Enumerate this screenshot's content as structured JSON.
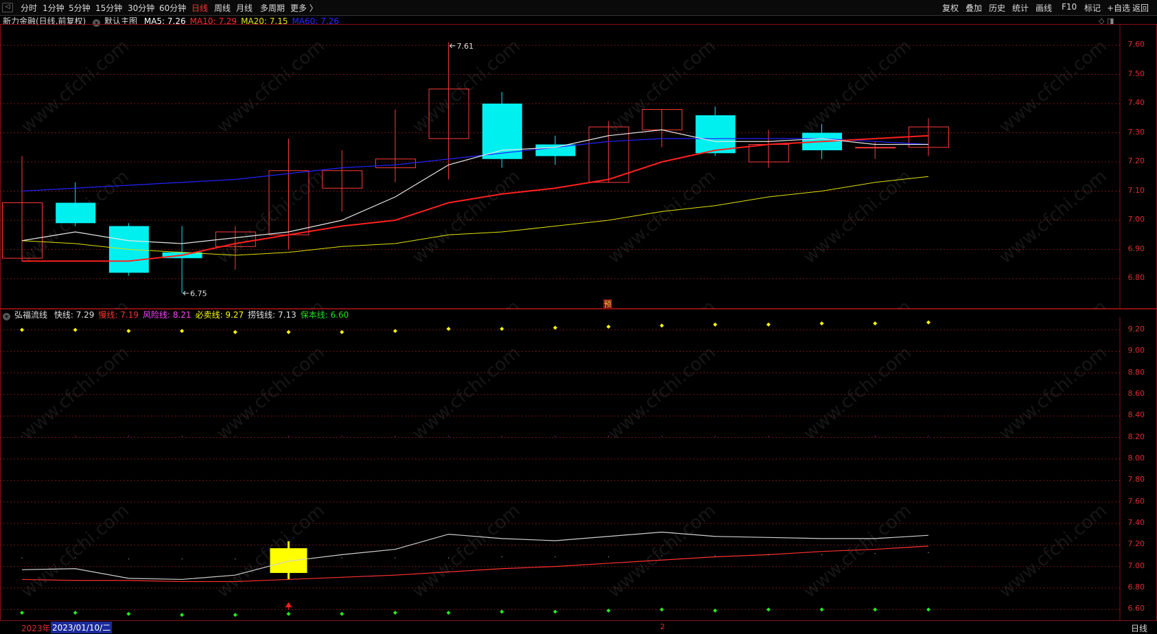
{
  "toolbar": {
    "periods": [
      "分时",
      "1分钟",
      "5分钟",
      "15分钟",
      "30分钟",
      "60分钟",
      "日线",
      "周线",
      "月线",
      "多周期",
      "更多 〉"
    ],
    "active_period": "日线",
    "right_items": [
      "复权",
      "叠加",
      "历史",
      "统计",
      "画线",
      "F10",
      "标记",
      "+自选",
      "返回"
    ]
  },
  "main_panel": {
    "stock_label": "新力金融(日线,前复权)",
    "template_label": "默认主图",
    "ma": [
      {
        "label": "MA5: 7.26",
        "color": "#ffffff"
      },
      {
        "label": "MA10: 7.29",
        "color": "#ff2a2a"
      },
      {
        "label": "MA20: 7.15",
        "color": "#e8e800"
      },
      {
        "label": "MA60: 7.26",
        "color": "#2a2aff"
      }
    ],
    "high_label": "7.61",
    "low_label": "6.75",
    "pre_label": "预",
    "y_ticks": [
      "7.60",
      "7.50",
      "7.40",
      "7.30",
      "7.20",
      "7.10",
      "7.00",
      "6.90",
      "6.80"
    ]
  },
  "sub_panel": {
    "indicator_name": "弘福流线",
    "values": [
      {
        "label": "快线: 7.29",
        "color": "#e0e0e0"
      },
      {
        "label": "慢线: 7.19",
        "color": "#ff3030"
      },
      {
        "label": "风险线: 8.21",
        "color": "#ff44ff"
      },
      {
        "label": "必卖线: 9.27",
        "color": "#ffff00"
      },
      {
        "label": "捞钱线: 7.13",
        "color": "#e0e0e0"
      },
      {
        "label": "保本线: 6.60",
        "color": "#22dd22"
      }
    ],
    "y_ticks": [
      "9.20",
      "9.00",
      "8.80",
      "8.60",
      "8.40",
      "8.20",
      "8.00",
      "7.80",
      "7.60",
      "7.40",
      "7.20",
      "7.00",
      "6.80",
      "6.60"
    ]
  },
  "footer": {
    "year": "2023年",
    "date": "2023/01/10/二",
    "marker": "2",
    "period": "日线"
  },
  "chart_data": {
    "type": "candlestick",
    "candles": [
      {
        "open": 6.87,
        "close": 7.06,
        "high": 7.22,
        "low": 6.86
      },
      {
        "open": 7.06,
        "close": 6.99,
        "high": 7.13,
        "low": 6.98
      },
      {
        "open": 6.98,
        "close": 6.82,
        "high": 6.99,
        "low": 6.81
      },
      {
        "open": 6.89,
        "close": 6.87,
        "high": 6.98,
        "low": 6.75
      },
      {
        "open": 6.91,
        "close": 6.96,
        "high": 6.98,
        "low": 6.83
      },
      {
        "open": 6.95,
        "close": 7.17,
        "high": 7.28,
        "low": 6.9
      },
      {
        "open": 7.11,
        "close": 7.17,
        "high": 7.24,
        "low": 7.03
      },
      {
        "open": 7.18,
        "close": 7.21,
        "high": 7.38,
        "low": 7.13
      },
      {
        "open": 7.28,
        "close": 7.45,
        "high": 7.61,
        "low": 7.14
      },
      {
        "open": 7.4,
        "close": 7.21,
        "high": 7.44,
        "low": 7.18
      },
      {
        "open": 7.26,
        "close": 7.22,
        "high": 7.29,
        "low": 7.19
      },
      {
        "open": 7.13,
        "close": 7.32,
        "high": 7.34,
        "low": 7.13
      },
      {
        "open": 7.31,
        "close": 7.38,
        "high": 7.38,
        "low": 7.25
      },
      {
        "open": 7.36,
        "close": 7.23,
        "high": 7.39,
        "low": 7.22
      },
      {
        "open": 7.2,
        "close": 7.26,
        "high": 7.31,
        "low": 7.18
      },
      {
        "open": 7.3,
        "close": 7.24,
        "high": 7.33,
        "low": 7.21
      },
      {
        "open": 7.25,
        "close": 7.25,
        "high": 7.27,
        "low": 7.21
      },
      {
        "open": 7.25,
        "close": 7.32,
        "high": 7.35,
        "low": 7.22
      }
    ],
    "ma5": [
      6.93,
      6.96,
      6.93,
      6.92,
      6.94,
      6.96,
      7.0,
      7.08,
      7.19,
      7.24,
      7.25,
      7.29,
      7.31,
      7.27,
      7.27,
      7.28,
      7.26,
      7.26
    ],
    "ma10": [
      6.86,
      6.86,
      6.86,
      6.88,
      6.92,
      6.95,
      6.98,
      7.0,
      7.06,
      7.09,
      7.11,
      7.14,
      7.2,
      7.24,
      7.26,
      7.27,
      7.28,
      7.29
    ],
    "ma20": [
      6.93,
      6.92,
      6.9,
      6.89,
      6.88,
      6.89,
      6.91,
      6.92,
      6.95,
      6.96,
      6.98,
      7.0,
      7.03,
      7.05,
      7.08,
      7.1,
      7.13,
      7.15
    ],
    "ma60": [
      7.1,
      7.11,
      7.12,
      7.13,
      7.14,
      7.16,
      7.18,
      7.19,
      7.21,
      7.23,
      7.25,
      7.27,
      7.28,
      7.28,
      7.28,
      7.28,
      7.27,
      7.26
    ],
    "ylim": [
      6.72,
      7.64
    ],
    "indicator": {
      "fast": [
        6.97,
        6.98,
        6.89,
        6.88,
        6.92,
        7.05,
        7.11,
        7.16,
        7.3,
        7.26,
        7.24,
        7.28,
        7.32,
        7.28,
        7.27,
        7.26,
        7.26,
        7.29
      ],
      "slow": [
        6.88,
        6.87,
        6.87,
        6.86,
        6.86,
        6.88,
        6.9,
        6.92,
        6.95,
        6.98,
        7.0,
        7.03,
        7.06,
        7.09,
        7.11,
        7.14,
        7.16,
        7.19
      ],
      "risk": [
        8.21,
        8.21,
        8.21,
        8.21,
        8.21,
        8.21,
        8.21,
        8.21,
        8.21,
        8.21,
        8.21,
        8.21,
        8.21,
        8.21,
        8.21,
        8.21,
        8.21,
        8.21
      ],
      "sell": [
        9.2,
        9.2,
        9.19,
        9.19,
        9.18,
        9.18,
        9.18,
        9.19,
        9.21,
        9.21,
        9.22,
        9.23,
        9.24,
        9.25,
        9.25,
        9.26,
        9.26,
        9.27
      ],
      "profit": [
        7.08,
        7.08,
        7.07,
        7.07,
        7.07,
        7.07,
        7.08,
        7.08,
        7.08,
        7.09,
        7.09,
        7.09,
        7.1,
        7.1,
        7.11,
        7.11,
        7.12,
        7.13
      ],
      "breakeven": [
        6.57,
        6.57,
        6.56,
        6.55,
        6.55,
        6.56,
        6.56,
        6.57,
        6.57,
        6.58,
        6.58,
        6.59,
        6.6,
        6.59,
        6.6,
        6.6,
        6.6,
        6.6
      ],
      "ylim": [
        6.5,
        9.32
      ],
      "signal_bar_index": 5,
      "signal_bar": {
        "low": 6.94,
        "high": 7.17
      }
    }
  }
}
